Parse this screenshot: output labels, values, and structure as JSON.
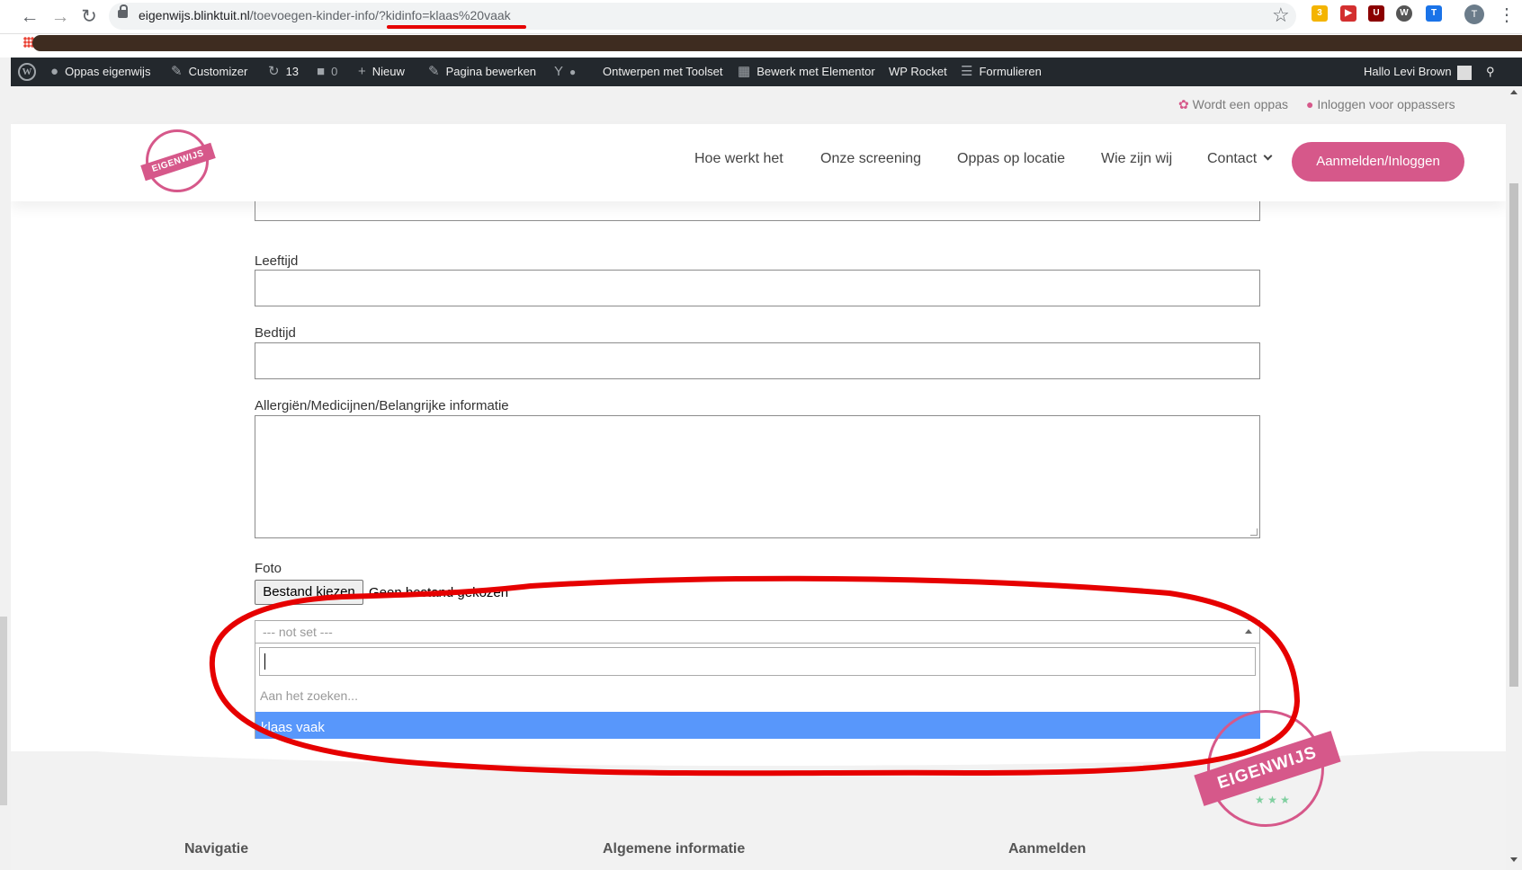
{
  "browser": {
    "url_host": "eigenwijs.blinktuit.nl",
    "url_path": "/toevoegen-kinder-info/",
    "url_query": "?kidinfo=klaas%20vaak",
    "extension_badge": "3",
    "profile_initial": "T"
  },
  "adminbar": {
    "site_name": "Oppas eigenwijs",
    "customizer": "Customizer",
    "updates_count": "13",
    "comments_count": "0",
    "new": "Nieuw",
    "edit_page": "Pagina bewerken",
    "toolset": "Ontwerpen met Toolset",
    "elementor": "Bewerk met Elementor",
    "wp_rocket": "WP Rocket",
    "forms": "Formulieren",
    "greeting": "Hallo Levi Brown"
  },
  "topbar": {
    "become_sitter": "Wordt een oppas",
    "login_sitters": "Inloggen voor oppassers"
  },
  "header": {
    "logo_text": "EIGENWIJS",
    "menu": [
      "Hoe werkt het",
      "Onze screening",
      "Oppas op locatie",
      "Wie zijn wij",
      "Contact"
    ],
    "cta": "Aanmelden/Inloggen"
  },
  "form": {
    "age_label": "Leeftijd",
    "bedtime_label": "Bedtijd",
    "info_label": "Allergiën/Medicijnen/Belangrijke informatie",
    "photo_label": "Foto",
    "file_button": "Bestand kiezen",
    "file_status": "Geen bestand gekozen",
    "select_value": "--- not set ---",
    "search_value": "",
    "searching_text": "Aan het zoeken...",
    "option": "klaas vaak"
  },
  "footer": {
    "col1": "Navigatie",
    "col2": "Algemene informatie",
    "col3": "Aanmelden",
    "stamp_text": "EIGENWIJS"
  },
  "colors": {
    "brand_pink": "#d6588a",
    "admin_bar": "#23282d",
    "option_highlight": "#5897fb",
    "annotation_red": "#e60000"
  }
}
